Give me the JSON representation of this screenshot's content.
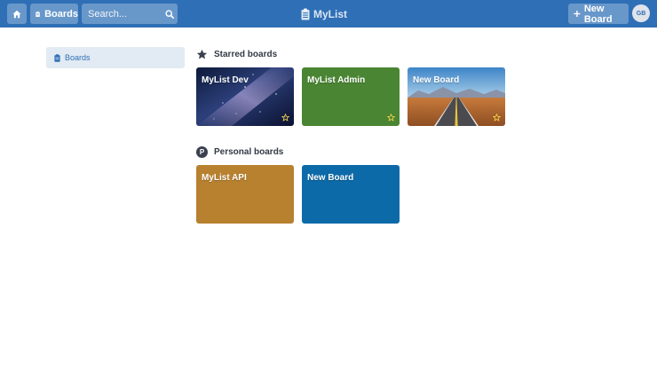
{
  "topbar": {
    "boards_label": "Boards",
    "search_placeholder": "Search...",
    "brand": "MyList",
    "new_board_label": "New Board",
    "avatar_initials": "GB"
  },
  "sidebar": {
    "items": [
      {
        "label": "Boards",
        "icon": "clipboard-icon"
      }
    ]
  },
  "sections": {
    "starred": {
      "title": "Starred boards",
      "icon": "star-icon",
      "boards": [
        {
          "title": "MyList Dev",
          "background": "galaxy-image",
          "starred": true
        },
        {
          "title": "MyList Admin",
          "background": "#4a8533",
          "starred": true
        },
        {
          "title": "New Board",
          "background": "desert-road-image",
          "starred": true
        }
      ]
    },
    "personal": {
      "title": "Personal boards",
      "icon_letter": "P",
      "boards": [
        {
          "title": "MyList API",
          "background": "#b8812f"
        },
        {
          "title": "New Board",
          "background": "#0c6aa8"
        }
      ]
    }
  },
  "colors": {
    "topbar": "#2f6fb6",
    "sidebar_active": "#e2eaf3",
    "star_outline": "#f2d34a"
  }
}
